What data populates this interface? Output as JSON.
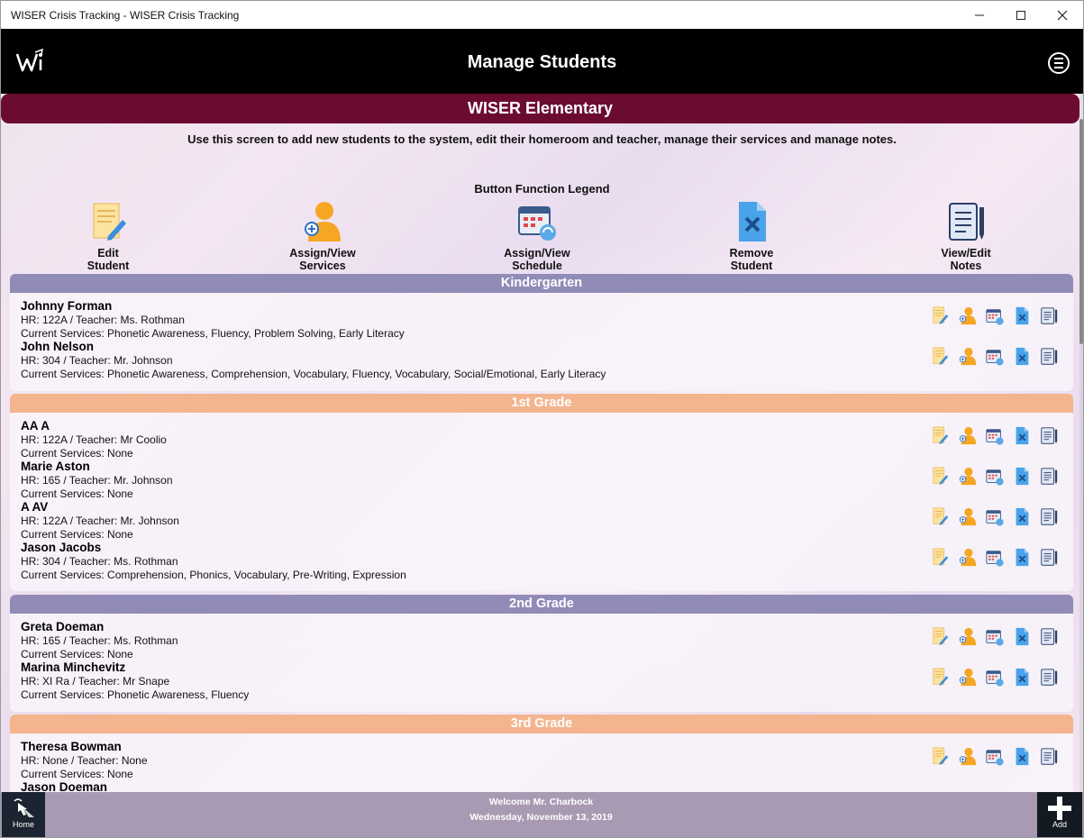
{
  "window": {
    "title": "WISER Crisis Tracking - WISER Crisis Tracking",
    "minimize": "—",
    "maximize": "☐",
    "close": "✕"
  },
  "header": {
    "title": "Manage Students",
    "menu_icon": "hamburger-circle-icon",
    "logo_icon": "wiser-logo"
  },
  "school": {
    "name": "WISER Elementary",
    "instructions": "Use this screen to add new students to the system, edit their homeroom and teacher, manage their services and manage notes."
  },
  "legend": {
    "title": "Button Function Legend",
    "items": [
      {
        "line1": "Edit",
        "line2": "Student",
        "icon": "edit-student-icon"
      },
      {
        "line1": "Assign/View",
        "line2": "Services",
        "icon": "assign-services-icon"
      },
      {
        "line1": "Assign/View",
        "line2": "Schedule",
        "icon": "schedule-icon"
      },
      {
        "line1": "Remove",
        "line2": "Student",
        "icon": "remove-student-icon"
      },
      {
        "line1": "View/Edit",
        "line2": "Notes",
        "icon": "notes-icon"
      }
    ]
  },
  "grades": [
    {
      "name": "Kindergarten",
      "color": "#918bb8",
      "students": [
        {
          "name": "Johnny Forman",
          "hr": "HR: 122A / Teacher: Ms. Rothman",
          "services": "Current Services: Phonetic Awareness, Fluency, Problem Solving, Early Literacy"
        },
        {
          "name": "John Nelson",
          "hr": "HR: 304 / Teacher: Mr. Johnson",
          "services": "Current Services: Phonetic Awareness, Comprehension, Vocabulary, Fluency, Vocabulary, Social/Emotional, Early Literacy"
        }
      ]
    },
    {
      "name": "1st Grade",
      "color": "#f4b48e",
      "students": [
        {
          "name": "AA A",
          "hr": "HR: 122A / Teacher: Mr Coolio",
          "services": "Current Services: None"
        },
        {
          "name": "Marie Aston",
          "hr": "HR: 165 / Teacher: Mr. Johnson",
          "services": "Current Services: None"
        },
        {
          "name": "A AV",
          "hr": "HR: 122A / Teacher: Mr. Johnson",
          "services": "Current Services: None"
        },
        {
          "name": "Jason Jacobs",
          "hr": "HR: 304 / Teacher: Ms. Rothman",
          "services": "Current Services: Comprehension, Phonics, Vocabulary, Pre-Writing, Expression"
        }
      ]
    },
    {
      "name": "2nd Grade",
      "color": "#918bb8",
      "students": [
        {
          "name": "Greta Doeman",
          "hr": "HR: 165 / Teacher: Ms. Rothman",
          "services": "Current Services: None"
        },
        {
          "name": "Marina Minchevitz",
          "hr": "HR: XI Ra / Teacher: Mr Snape",
          "services": "Current Services: Phonetic Awareness, Fluency"
        }
      ]
    },
    {
      "name": "3rd Grade",
      "color": "#f4b48e",
      "students": [
        {
          "name": "Theresa Bowman",
          "hr": "HR: None / Teacher: None",
          "services": "Current Services: None"
        },
        {
          "name": "Jason Doeman",
          "hr": "",
          "services": ""
        }
      ]
    }
  ],
  "footer": {
    "welcome": "Welcome Mr. Charbock",
    "date": "Wednesday, November 13, 2019",
    "home_label": "Home",
    "add_label": "Add"
  },
  "colors": {
    "banner": "#6c0b31",
    "header_bg": "#000000",
    "purple_header": "#918bb8",
    "peach_header": "#f4b48e",
    "footer": "#a398b0"
  }
}
